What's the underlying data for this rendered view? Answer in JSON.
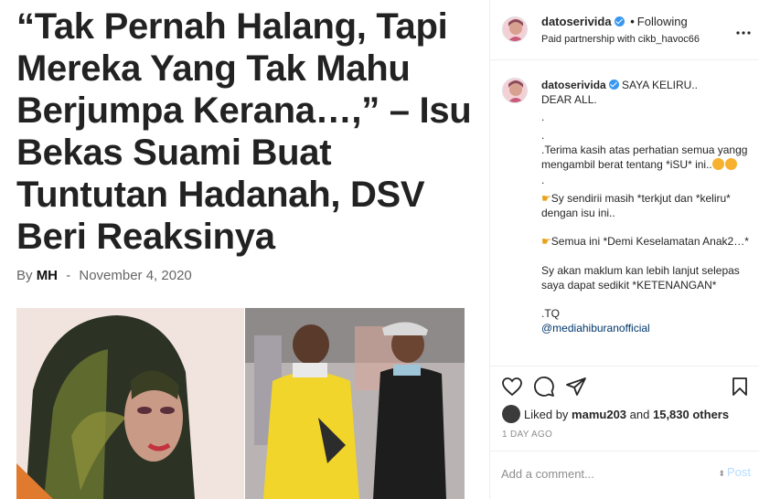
{
  "article": {
    "headline": "“Tak Pernah Halang, Tapi Mereka Yang Tak Mahu Berjumpa Kerana…,” – Isu Bekas Suami Buat Tuntutan Hadanah, DSV Beri Reaksinya",
    "by_label": "By",
    "author": "MH",
    "separator": "-",
    "date": "November 4, 2020"
  },
  "post": {
    "username": "datoserivida",
    "dot": "•",
    "following_label": "Following",
    "partnership": "Paid partnership with cikb_havoc66",
    "more_icon": "more-horizontal-icon",
    "caption_username": "datoserivida",
    "caption_lines": {
      "l1": "SAYA KELIRU..",
      "l2": "DEAR ALL.",
      "l3": ".",
      "l4": ".",
      "l5": ".Terima kasih atas perhatian semua yangg mengambil berat tentang *iSU* ini..",
      "l6": ".",
      "l7": "Sy sendirii masih *terkjut dan *keliru* dengan isu ini..",
      "l8": "Semua ini *Demi Keselamatan Anak2…*",
      "l9": "Sy akan maklum kan lebih lanjut selepas saya dapat sedikit *KETENANGAN*",
      "l10": ".TQ",
      "l11": "@mediahiburanofficial"
    },
    "liked_by_label": "Liked by",
    "liked_by_user": "mamu203",
    "and_label": "and",
    "others_count": "15,830 others",
    "timestamp": "1 DAY AGO",
    "comment_placeholder": "Add a comment...",
    "post_label": "Post",
    "colors": {
      "verified": "#3897f0",
      "post_disabled": "#b3dbff",
      "border": "#efefef"
    }
  }
}
